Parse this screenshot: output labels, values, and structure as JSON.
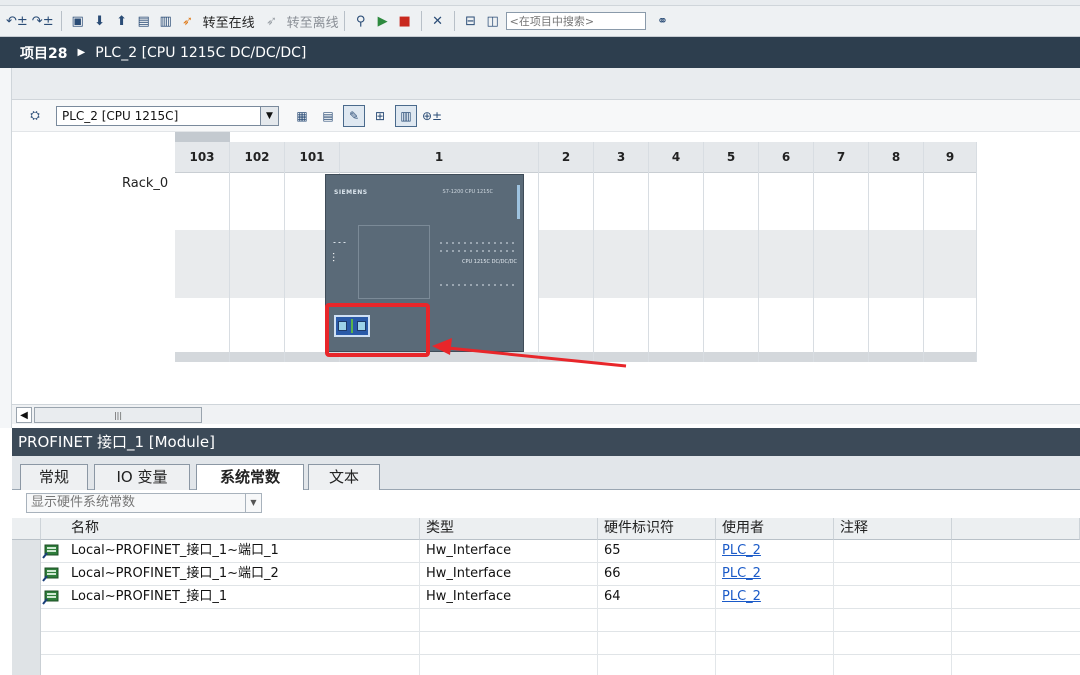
{
  "toolbar": {
    "go_online": "转至在线",
    "go_offline": "转至离线",
    "search_placeholder": "<在项目中搜索>"
  },
  "title": {
    "project": "项目28",
    "device": "PLC_2 [CPU 1215C DC/DC/DC]"
  },
  "device_view": {
    "device_selector": "PLC_2 [CPU 1215C]",
    "rack_name": "Rack_0",
    "slots": [
      "103",
      "102",
      "101",
      "1",
      "2",
      "3",
      "4",
      "5",
      "6",
      "7",
      "8",
      "9"
    ],
    "cpu_brand": "SIEMENS",
    "cpu_model": "S7-1200 CPU 1215C",
    "cpu_label": "CPU 1215C DC/DC/DC"
  },
  "properties": {
    "title": "PROFINET 接口_1 [Module]",
    "tabs": [
      "常规",
      "IO 变量",
      "系统常数",
      "文本"
    ],
    "active_tab": "系统常数",
    "filter": "显示硬件系统常数",
    "columns": [
      "名称",
      "类型",
      "硬件标识符",
      "使用者",
      "注释"
    ],
    "rows": [
      {
        "name": "Local~PROFINET_接口_1~端口_1",
        "type": "Hw_Interface",
        "hw_id": "65",
        "user": "PLC_2",
        "comment": ""
      },
      {
        "name": "Local~PROFINET_接口_1~端口_2",
        "type": "Hw_Interface",
        "hw_id": "66",
        "user": "PLC_2",
        "comment": ""
      },
      {
        "name": "Local~PROFINET_接口_1",
        "type": "Hw_Interface",
        "hw_id": "64",
        "user": "PLC_2",
        "comment": ""
      }
    ]
  },
  "colors": {
    "title_bar": "#2d3e4e",
    "highlight": "#e8262a",
    "link": "#1a5ac8"
  }
}
